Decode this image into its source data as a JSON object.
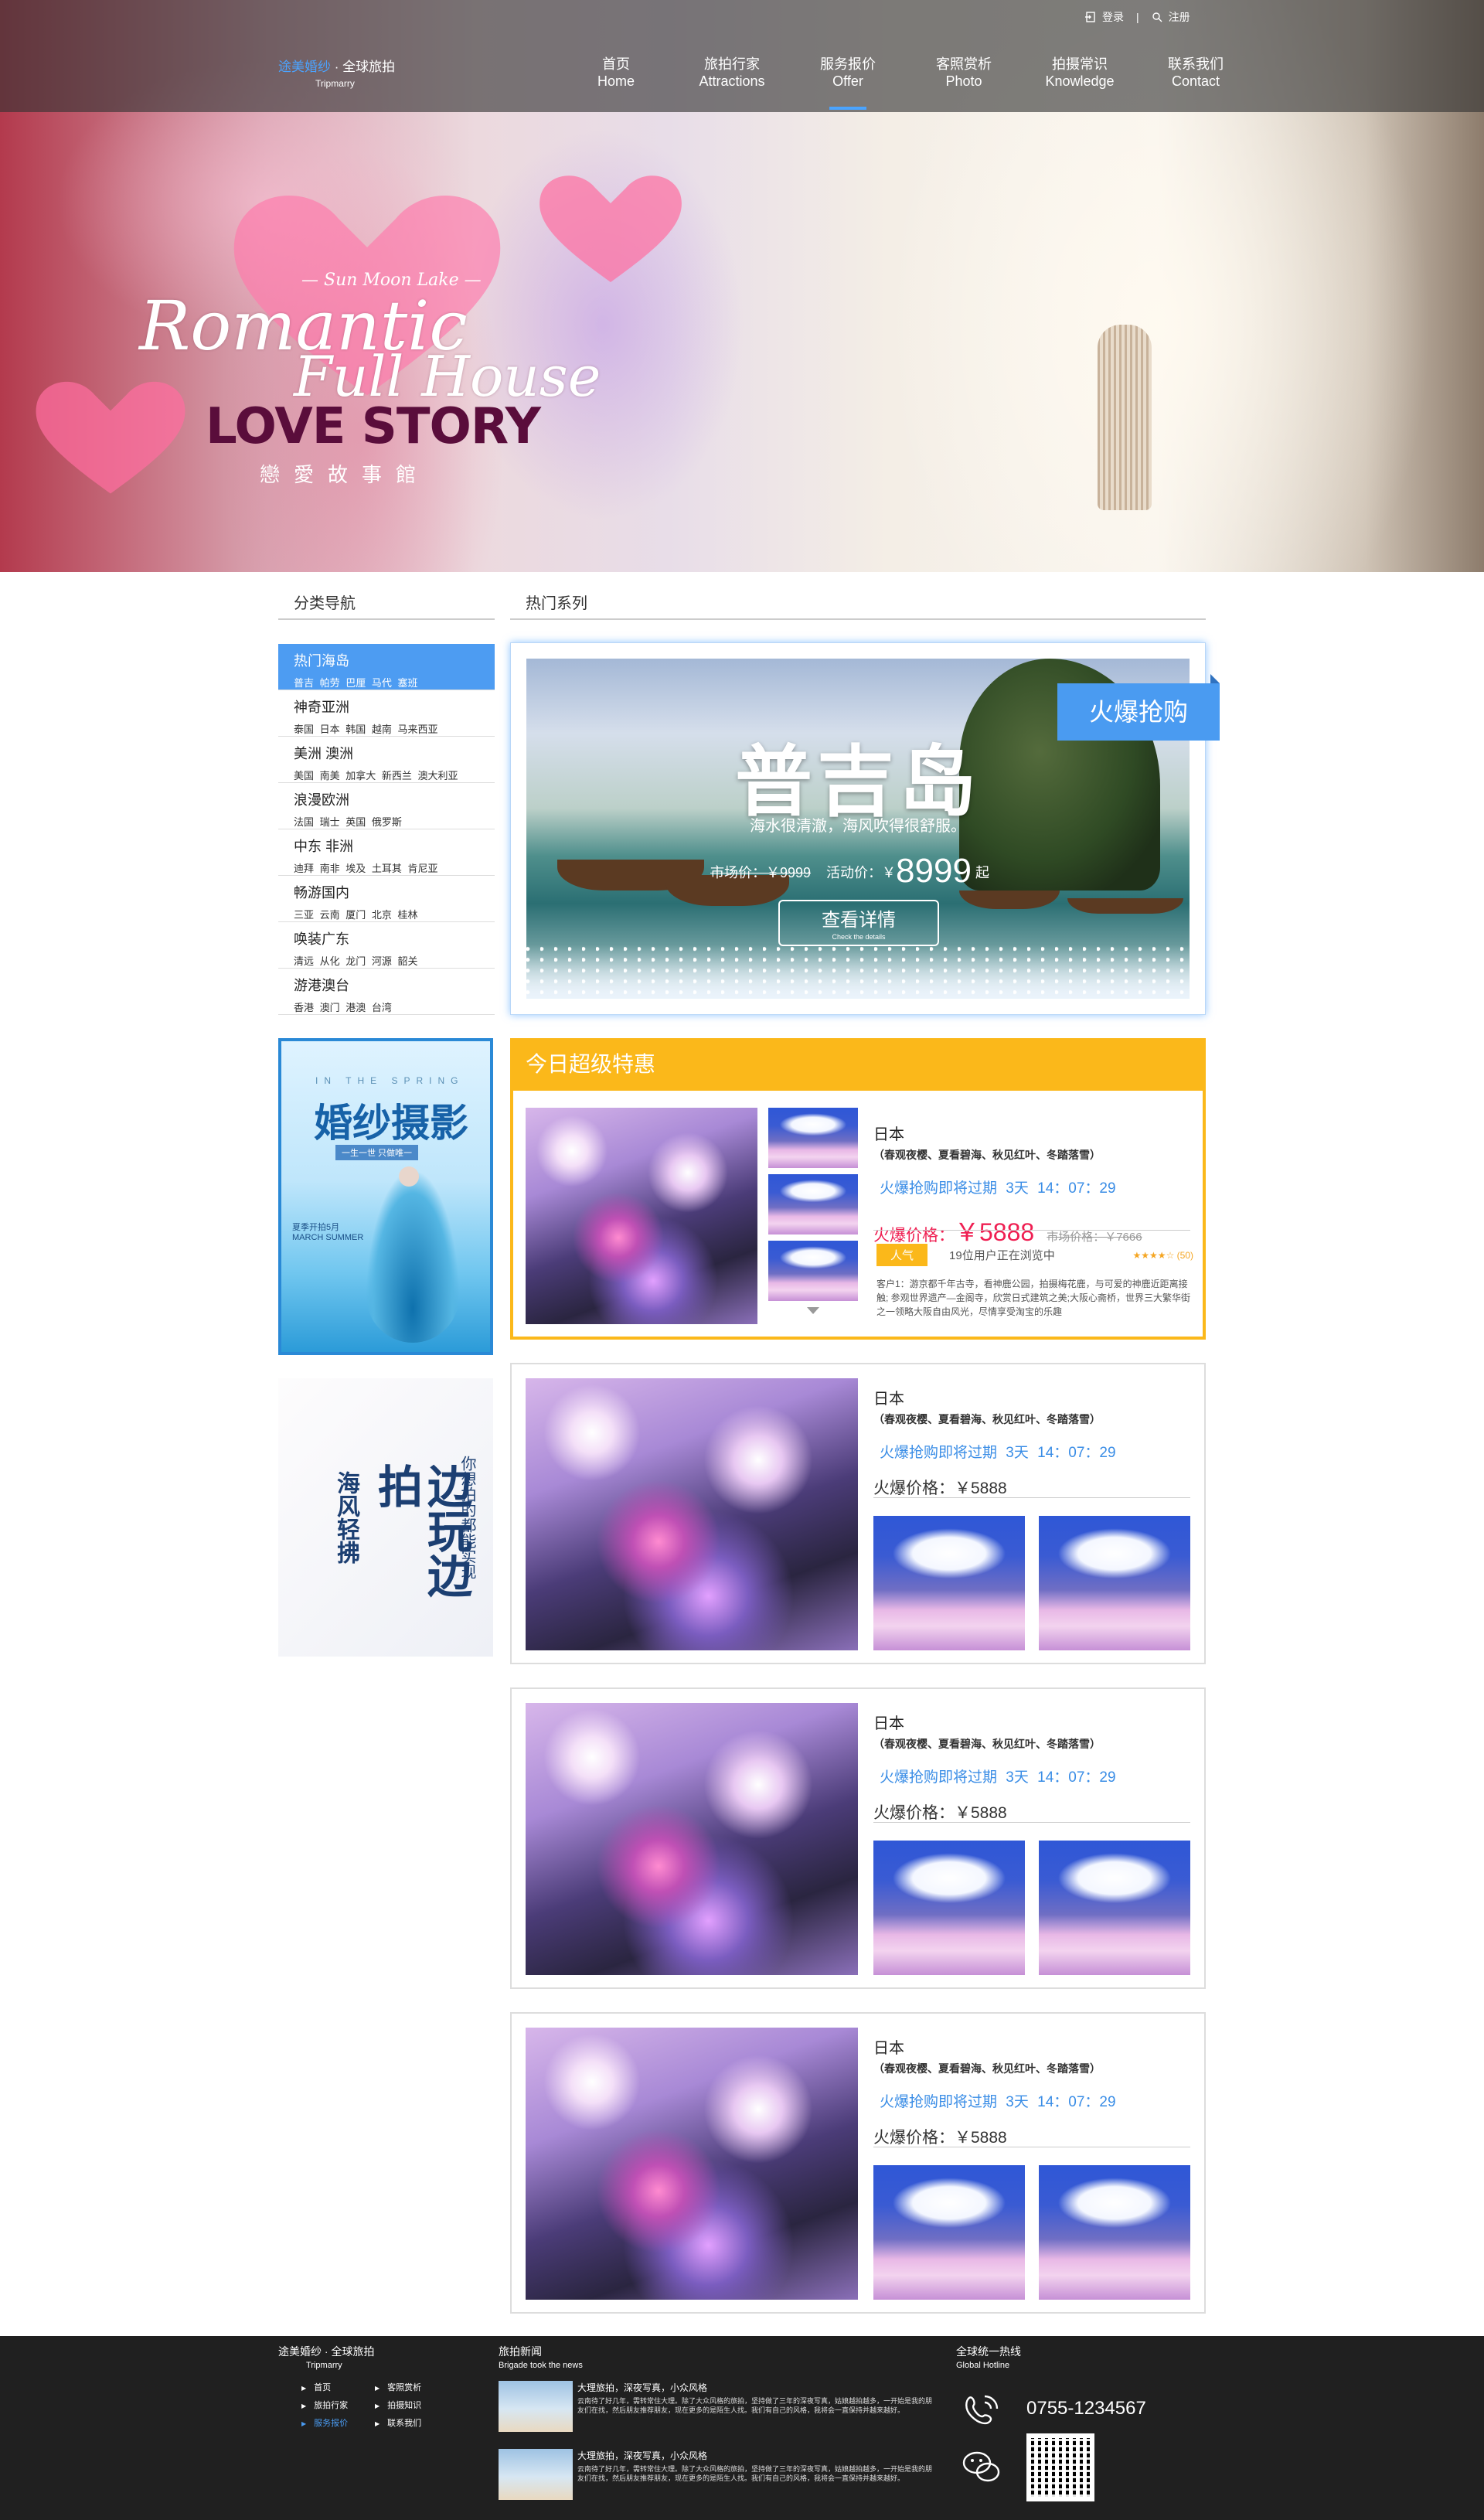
{
  "header": {
    "brand_prefix": "途美婚纱",
    "brand_suffix": "· 全球旅拍",
    "brand_en": "Tripmarry",
    "login": "登录",
    "register": "注册",
    "nav": [
      {
        "cn": "首页",
        "en": "Home"
      },
      {
        "cn": "旅拍行家",
        "en": "Attractions"
      },
      {
        "cn": "服务报价",
        "en": "Offer"
      },
      {
        "cn": "客照赏析",
        "en": "Photo"
      },
      {
        "cn": "拍摄常识",
        "en": "Knowledge"
      },
      {
        "cn": "联系我们",
        "en": "Contact"
      }
    ],
    "active_nav": "Offer"
  },
  "hero": {
    "small": "— Sun Moon Lake —",
    "line1": "Romantic",
    "line2": "Full House",
    "line3": "LOVE STORY",
    "cn": "戀愛故事館"
  },
  "sidebar": {
    "title": "分类导航",
    "categories": [
      {
        "name": "热门海岛",
        "sub": "普吉 帕劳 巴厘 马代 塞班"
      },
      {
        "name": "神奇亚洲",
        "sub": "泰国 日本 韩国 越南 马来西亚"
      },
      {
        "name": "美洲 澳洲",
        "sub": "美国 南美 加拿大 新西兰 澳大利亚"
      },
      {
        "name": "浪漫欧洲",
        "sub": "法国 瑞士 英国 俄罗斯"
      },
      {
        "name": "中东 非洲",
        "sub": "迪拜 南非 埃及 土耳其 肯尼亚"
      },
      {
        "name": "畅游国内",
        "sub": "三亚 云南 厦门 北京 桂林"
      },
      {
        "name": "唤装广东",
        "sub": "清远 从化 龙门 河源 韶关"
      },
      {
        "name": "游港澳台",
        "sub": "香港 澳门 港澳 台湾"
      }
    ],
    "ad1": {
      "top": "IN THE SPRING",
      "title": "婚纱摄影",
      "sub": "一生一世 只做唯一",
      "line1": "夏季开拍5月",
      "line2": "MARCH SUMMER"
    },
    "ad2": {
      "a": "海风轻拂",
      "b": "边玩边拍",
      "c": "你想拍的都能实现"
    }
  },
  "main": {
    "title": "热门系列",
    "feature": {
      "tag": "火爆抢购",
      "title": "普吉岛",
      "subtitle": "海水很清澈，海风吹得很舒服。",
      "market_price": "市场价：￥9999",
      "activity_label": "活动价：￥",
      "activity_value": "8999",
      "activity_suffix": "起",
      "btn": "查看详情",
      "btn_en": "Check the details"
    },
    "today": {
      "title": "今日超级特惠",
      "country": "日本",
      "note": "（春观夜樱、夏看碧海、秋见红叶、冬踏落雪）",
      "countdown": "火爆抢购即将过期 3天 14：07：29",
      "price_label": "火爆价格：",
      "price": "￥5888",
      "market": "市场价格：￥7666",
      "badge": "人气",
      "viewers": "19位用户正在浏览中",
      "stars": "★★★★☆ (50)",
      "desc": "客户1：游京都千年古寺，看神鹿公园，拍摄梅花鹿，与可爱的神鹿近距离接触; 参观世界遗产—金阁寺，欣赏日式建筑之美;大阪心斋桥，世界三大繁华街之一领略大阪自由风光，尽情享受淘宝的乐趣"
    },
    "cards": [
      {
        "country": "日本",
        "note": "（春观夜樱、夏看碧海、秋见红叶、冬踏落雪）",
        "countdown": "火爆抢购即将过期 3天 14：07：29",
        "price": "火爆价格：￥5888"
      },
      {
        "country": "日本",
        "note": "（春观夜樱、夏看碧海、秋见红叶、冬踏落雪）",
        "countdown": "火爆抢购即将过期 3天 14：07：29",
        "price": "火爆价格：￥5888"
      },
      {
        "country": "日本",
        "note": "（春观夜樱、夏看碧海、秋见红叶、冬踏落雪）",
        "countdown": "火爆抢购即将过期 3天 14：07：29",
        "price": "火爆价格：￥5888"
      }
    ]
  },
  "footer": {
    "brand": "途美婚纱 · 全球旅拍",
    "brand_en": "Tripmarry",
    "links": [
      "首页",
      "客照赏析",
      "旅拍行家",
      "拍摄知识",
      "服务报价",
      "联系我们"
    ],
    "active_link": "服务报价",
    "news_title": "旅拍新闻",
    "news_en": "Brigade took the news",
    "news": [
      {
        "title": "大理旅拍，深夜写真，小众风格",
        "desc": "云南待了好几年，需转常住大理。除了大众风格的旅拍，坚持做了三年的深夜写真，姑娘越拍越多，一开始是我的朋友们在找，然后朋友推荐朋友，现在更多的是陌生人找。我们有自己的风格，我将会一直保持并越来越好。"
      },
      {
        "title": "大理旅拍，深夜写真，小众风格",
        "desc": "云南待了好几年，需转常住大理。除了大众风格的旅拍，坚持做了三年的深夜写真，姑娘越拍越多，一开始是我的朋友们在找，然后朋友推荐朋友，现在更多的是陌生人找。我们有自己的风格，我将会一直保持并越来越好。"
      }
    ],
    "hotline_title": "全球统一热线",
    "hotline_en": "Global Hotline",
    "phone": "0755-1234567"
  },
  "colors": {
    "accent_blue": "#4a9bf1",
    "accent_yellow": "#fbb81a",
    "hot_red": "#ef1f52",
    "footer_bg": "#202020"
  }
}
